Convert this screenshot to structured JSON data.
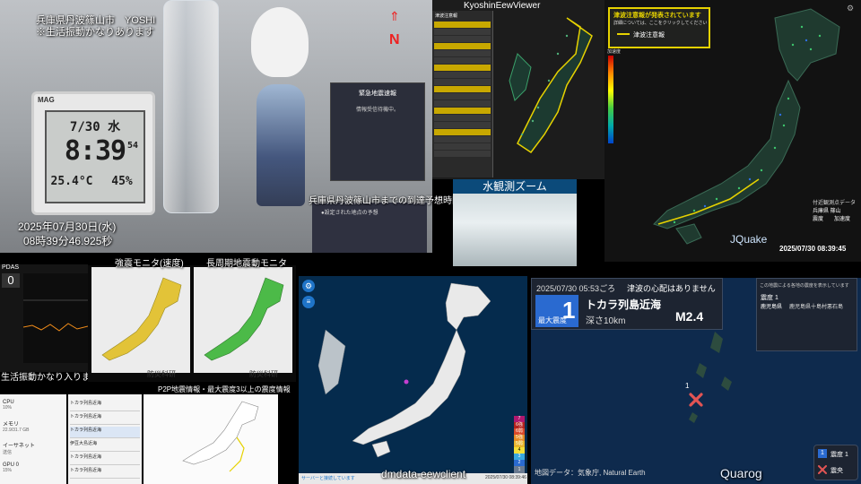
{
  "camera": {
    "location": "兵庫県丹波篠山市　YOSHI",
    "note": "※生活振動かなりあります",
    "north": "N",
    "date": "2025年07月30日(水)",
    "time": "08時39分46.925秒",
    "clock": {
      "brand": "MAG",
      "date": "7/30 水",
      "time": "8:39",
      "sec": "54",
      "temp": "25.4°C",
      "humid": "45%"
    },
    "eew_title": "緊急地震速報",
    "eew_status": "情報受信待機中。",
    "eta_title": "兵庫県丹波篠山市までの到達予想時間",
    "eta_item": "●設定された地点の予想"
  },
  "kyoshin": {
    "title": "KyoshinEewViewer",
    "list_title": "津波注意報",
    "zoom_title": "水観測ズーム"
  },
  "jquake": {
    "banner": "津波注意報が発表されています",
    "banner_sub": "詳細については、ここをクリックしてください",
    "legend_item": "津波注意報",
    "legend_title": "加速度",
    "stations_title": "付近観測点データ",
    "station": "兵庫県 篠山",
    "legend_labels": [
      "震度",
      "加速度"
    ],
    "name": "JQuake",
    "timestamp": "2025/07/30 08:39:45"
  },
  "pdas": {
    "title": "PDAS",
    "value": "0",
    "caption": "生活振動かなり入ります"
  },
  "monitors": {
    "strong": "強震モニタ(速度)",
    "long": "長周期地震動モニタ",
    "credit": "防災科研"
  },
  "system": [
    {
      "name": "CPU",
      "value": "10%"
    },
    {
      "name": "メモリ",
      "value": "22.9/31.7 GB"
    },
    {
      "name": "イーサネット",
      "value": "送信"
    },
    {
      "name": "GPU 0",
      "value": "15%"
    }
  ],
  "p2p": {
    "title": "P2P地震情報・最大震度3以上の震度情報",
    "rows": [
      "トカラ列島近海",
      "トカラ列島近海",
      "トカラ列島近海",
      "伊豆大島近海",
      "トカラ列島近海",
      "トカラ列島近海"
    ]
  },
  "dmdata": {
    "name": "dmdata-eewclient",
    "status": "サーバーと接続しています",
    "footer_time": "2025/07/30 08:39:46",
    "scale": [
      "7",
      "6強",
      "6弱",
      "5強",
      "5弱",
      "4",
      "3",
      "2",
      "1"
    ]
  },
  "quarog": {
    "time": "2025/07/30 05:53ごろ",
    "tsunami": "津波の心配はありません",
    "area": "トカラ列島近海",
    "maxint_label": "最大震度",
    "maxint": "1",
    "depth": "深さ10km",
    "mag": "M2.4",
    "side_title": "この地震による各地の震度を表示しています",
    "side_intensity": "震度 1",
    "side_pref": "鹿児島県",
    "side_city": "鹿児島県十島村悪石島",
    "attribution": "地図データ：気象庁, Natural Earth",
    "legend_int": "震度 1",
    "legend_epi": "震央",
    "name": "Quarog"
  },
  "colors": {
    "accent_yellow": "#e6d200",
    "epicenter": "#e25454",
    "map_ocean": "#0e2a4d"
  }
}
